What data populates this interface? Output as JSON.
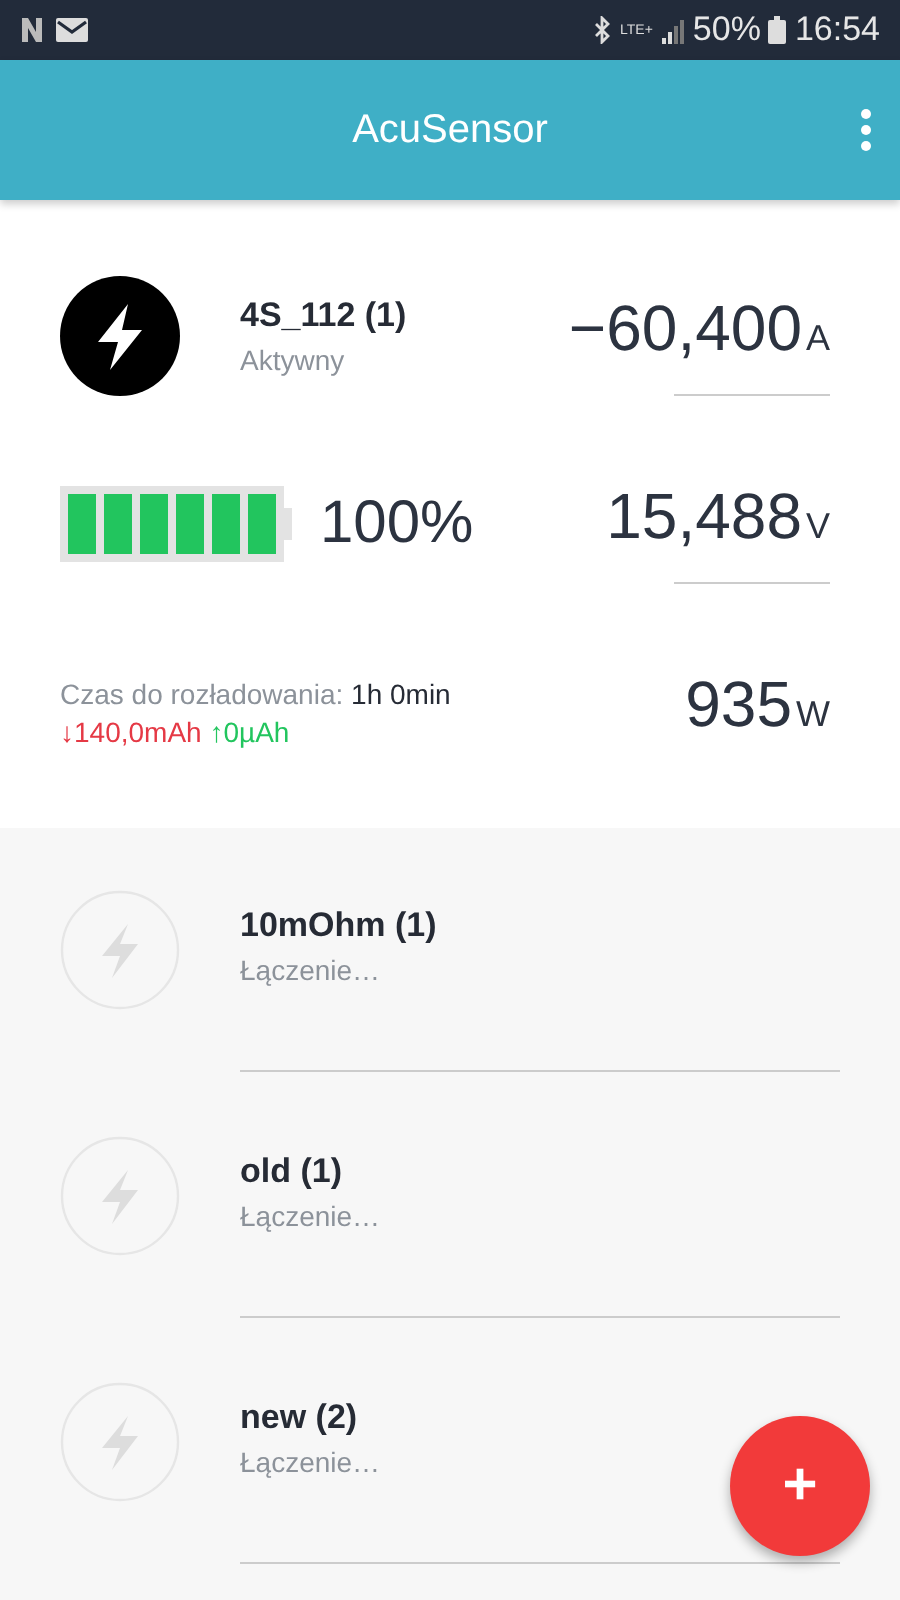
{
  "status_bar": {
    "network": "LTE+",
    "battery": "50%",
    "time": "16:54"
  },
  "app_bar": {
    "title": "AcuSensor"
  },
  "active_device": {
    "name": "4S_112 (1)",
    "status": "Aktywny",
    "battery": {
      "percent": "100%"
    },
    "readings": [
      {
        "value": "−60,400",
        "unit": "A"
      },
      {
        "value": "15,488",
        "unit": "V"
      },
      {
        "value": "935",
        "unit": "W"
      }
    ],
    "discharge_label": "Czas do rozładowania:",
    "discharge_time": "1h 0min",
    "charge_out": "↓140,0mAh",
    "charge_in": "↑0µAh"
  },
  "devices": [
    {
      "name": "10mOhm (1)",
      "status": "Łączenie…"
    },
    {
      "name": "old (1)",
      "status": "Łączenie…"
    },
    {
      "name": "new (2)",
      "status": "Łączenie…"
    }
  ],
  "fab": {
    "label": "+"
  }
}
